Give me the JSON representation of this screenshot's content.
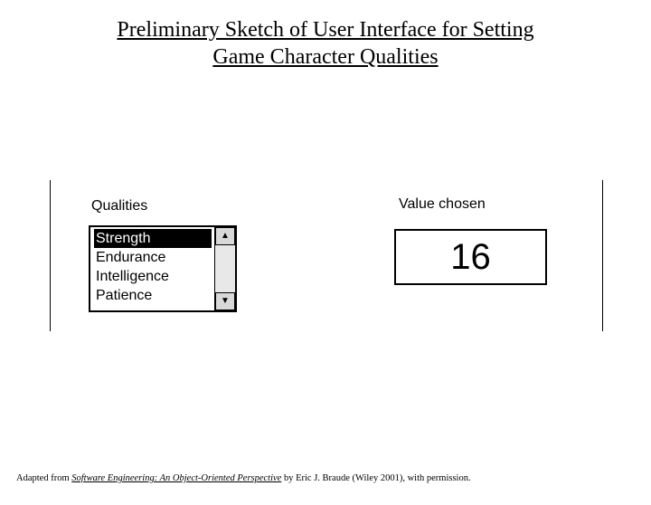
{
  "title_line1": "Preliminary Sketch of User Interface for Setting",
  "title_line2": "Game Character Qualities",
  "labels": {
    "qualities": "Qualities",
    "value_chosen": "Value chosen"
  },
  "qualities_list": {
    "selected_index": 0,
    "items": [
      "Strength",
      "Endurance",
      "Intelligence",
      "Patience"
    ]
  },
  "value_chosen": "16",
  "footnote": {
    "prefix": "Adapted from ",
    "book": "Software Engineering: An Object-Oriented Perspective",
    "suffix": " by Eric J. Braude (Wiley 2001), with permission."
  }
}
